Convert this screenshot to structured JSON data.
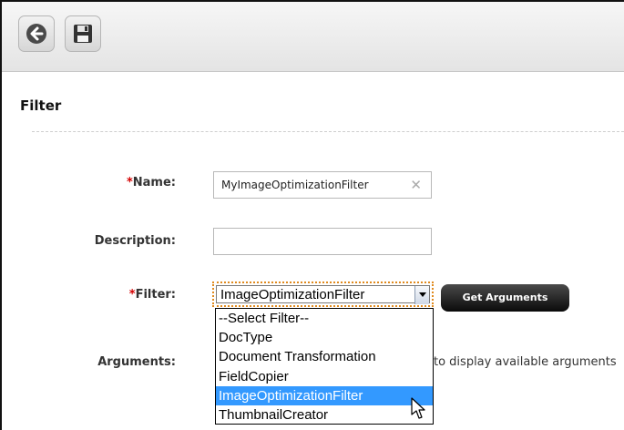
{
  "toolbar": {
    "back_icon": "back-arrow-icon",
    "save_icon": "floppy-disk-icon"
  },
  "section": {
    "title": "Filter"
  },
  "form": {
    "name_required": "*",
    "name_label": "Name:",
    "name_value": "MyImageOptimizationFilter",
    "description_label": "Description:",
    "description_value": "",
    "filter_required": "*",
    "filter_label": "Filter:",
    "filter_selected": "ImageOptimizationFilter",
    "filter_options": [
      "--Select Filter--",
      "DocType",
      "Document Transformation",
      "FieldCopier",
      "ImageOptimizationFilter",
      "ThumbnailCreator"
    ],
    "get_arguments_label": "Get Arguments",
    "arguments_label": "Arguments:",
    "arguments_hint": "to display available arguments"
  },
  "colors": {
    "required": "#d40000",
    "selection": "#3399ff",
    "focus_outline": "#e08a1e"
  }
}
